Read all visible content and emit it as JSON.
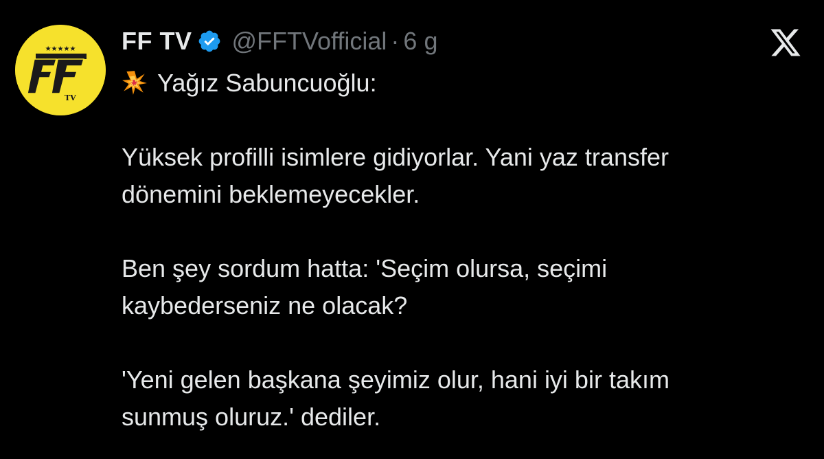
{
  "tweet": {
    "author": {
      "display_name": "FF TV",
      "handle": "@FFTVofficial",
      "verified": true,
      "avatar_icon": "ff-tv-logo"
    },
    "separator": "·",
    "time": "6 g",
    "platform_icon": "x-logo-icon",
    "emoji_icon": "collision-icon",
    "lines": {
      "title": "Yağız Sabuncuoğlu:",
      "p1_l1": "Yüksek profilli isimlere gidiyorlar. Yani yaz transfer",
      "p1_l2": "dönemini beklemeyecekler.",
      "p2_l1": "Ben şey sordum hatta: 'Seçim olursa, seçimi",
      "p2_l2": "kaybederseniz ne olacak?",
      "p3_l1": "'Yeni gelen başkana şeyimiz olur, hani iyi bir takım",
      "p3_l2": "sunmuş oluruz.' dediler."
    }
  },
  "colors": {
    "background": "#000000",
    "text": "#e7e9ea",
    "muted": "#71767b",
    "verified": "#1d9bf0",
    "avatar_bg": "#f6e12c"
  }
}
